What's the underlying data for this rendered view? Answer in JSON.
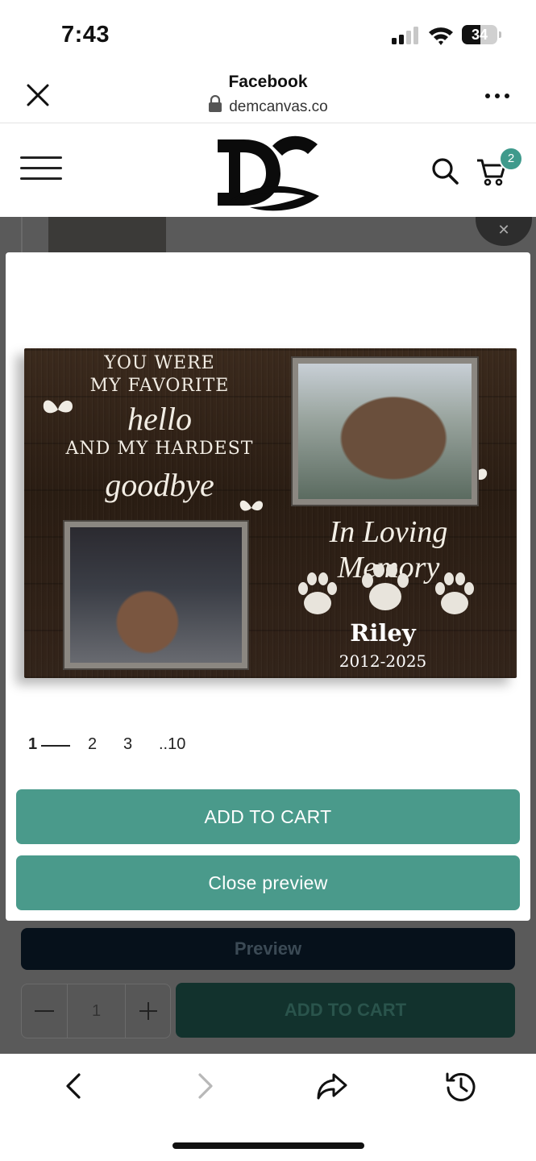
{
  "status_bar": {
    "time": "7:43",
    "battery": "34"
  },
  "browser": {
    "title": "Facebook",
    "url": "demcanvas.co"
  },
  "header": {
    "cart_count": "2"
  },
  "modal": {
    "canvas": {
      "quote_line1": "YOU WERE",
      "quote_line2": "MY FAVORITE",
      "quote_hello": "hello",
      "quote_line3": "AND MY HARDEST",
      "quote_goodbye": "goodbye",
      "memory_text": "In Loving Memory",
      "pet_name": "Riley",
      "pet_years": "2012-2025"
    },
    "pagination": [
      {
        "label": "1",
        "active": true
      },
      {
        "label": "2",
        "active": false
      },
      {
        "label": "3",
        "active": false
      },
      {
        "label": "..10",
        "active": false
      }
    ],
    "add_to_cart_label": "ADD TO CART",
    "close_preview_label": "Close preview"
  },
  "background_page": {
    "preview_label": "Preview",
    "quantity": "1",
    "add_to_cart_label": "ADD TO CART"
  },
  "colors": {
    "accent": "#4a9a8b",
    "badge": "#3f9a8c",
    "overlay": "#5a5a5a"
  },
  "icons": [
    "close-icon",
    "lock-icon",
    "more-icon",
    "menu-icon",
    "search-icon",
    "cart-icon",
    "back-icon",
    "forward-icon",
    "share-icon",
    "history-icon"
  ]
}
